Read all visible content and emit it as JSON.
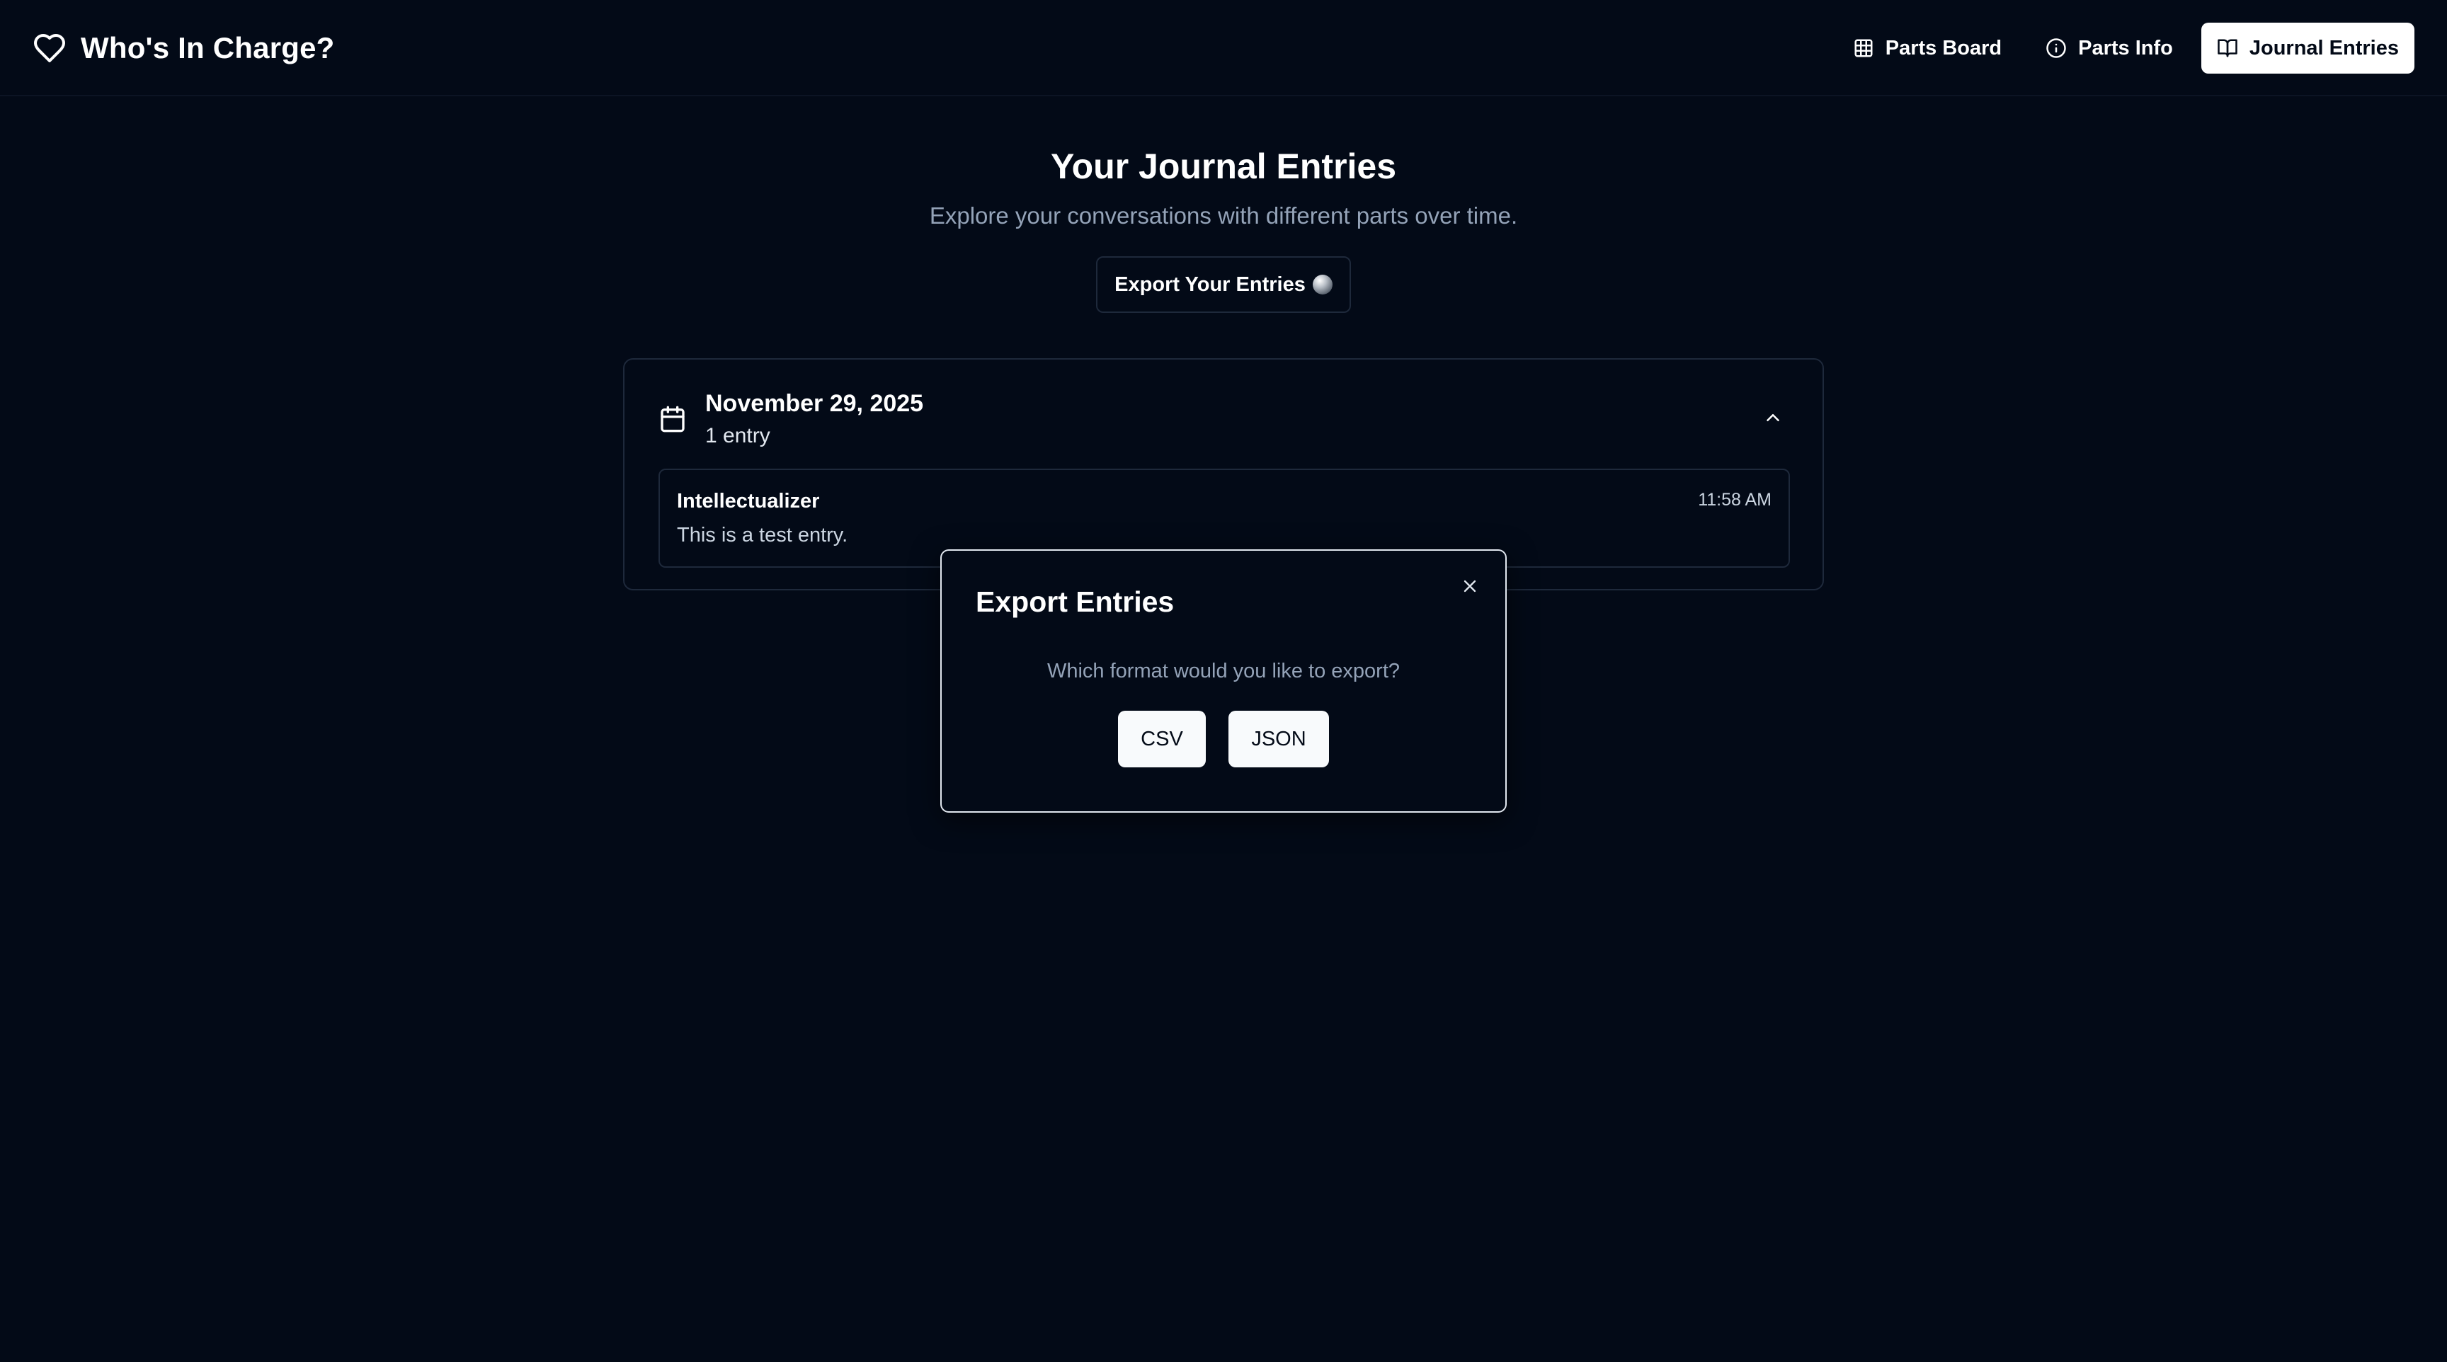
{
  "app": {
    "title": "Who's In Charge?",
    "logo_icon": "heart-icon"
  },
  "nav": {
    "items": [
      {
        "label": "Parts Board",
        "icon": "grid-icon",
        "active": false
      },
      {
        "label": "Parts Info",
        "icon": "info-icon",
        "active": false
      },
      {
        "label": "Journal Entries",
        "icon": "book-open-icon",
        "active": true
      }
    ]
  },
  "page": {
    "title": "Your Journal Entries",
    "subtitle": "Explore your conversations with different parts over time.",
    "export_label": "Export Your Entries"
  },
  "groups": [
    {
      "date": "November 29, 2025",
      "count": "1 entry",
      "icon": "calendar-icon",
      "expanded": true,
      "entries": [
        {
          "part": "Intellectualizer",
          "time": "11:58 AM",
          "text": "This is a test entry."
        }
      ]
    }
  ],
  "modal": {
    "title": "Export Entries",
    "question": "Which format would you like to export?",
    "options": [
      "CSV",
      "JSON"
    ]
  },
  "colors": {
    "background": "#030a17",
    "border": "#1e293b",
    "muted_text": "#94a3b8",
    "active_nav_bg": "#ffffff"
  }
}
